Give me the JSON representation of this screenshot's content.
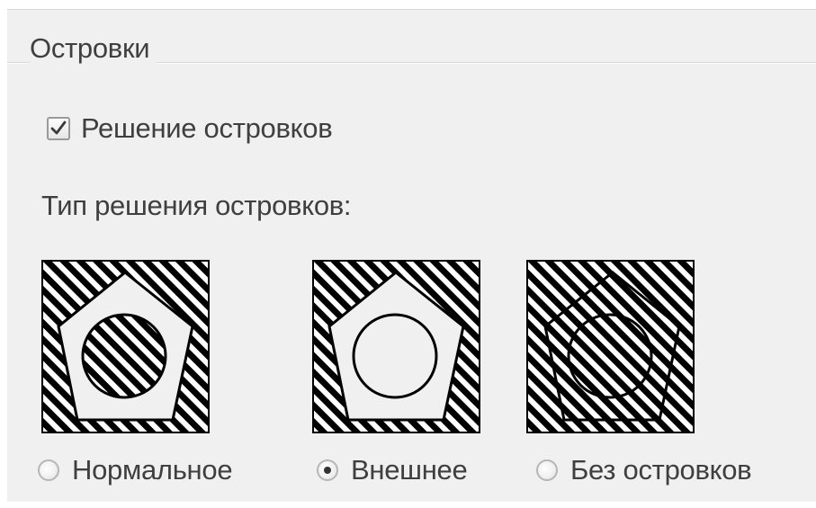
{
  "group": {
    "title": "Островки"
  },
  "island_detection": {
    "checkbox_label": "Решение островков",
    "checked": true
  },
  "island_style": {
    "label": "Тип решения островков:",
    "options": [
      {
        "label": "Нормальное",
        "selected": false,
        "icon": "normal-island-style-icon"
      },
      {
        "label": "Внешнее",
        "selected": true,
        "icon": "outer-island-style-icon"
      },
      {
        "label": "Без островков",
        "selected": false,
        "icon": "ignore-island-style-icon"
      }
    ]
  },
  "colors": {
    "panel_background": "#f0f0f0",
    "text": "#3f3f3f",
    "hatch": "#000000"
  }
}
